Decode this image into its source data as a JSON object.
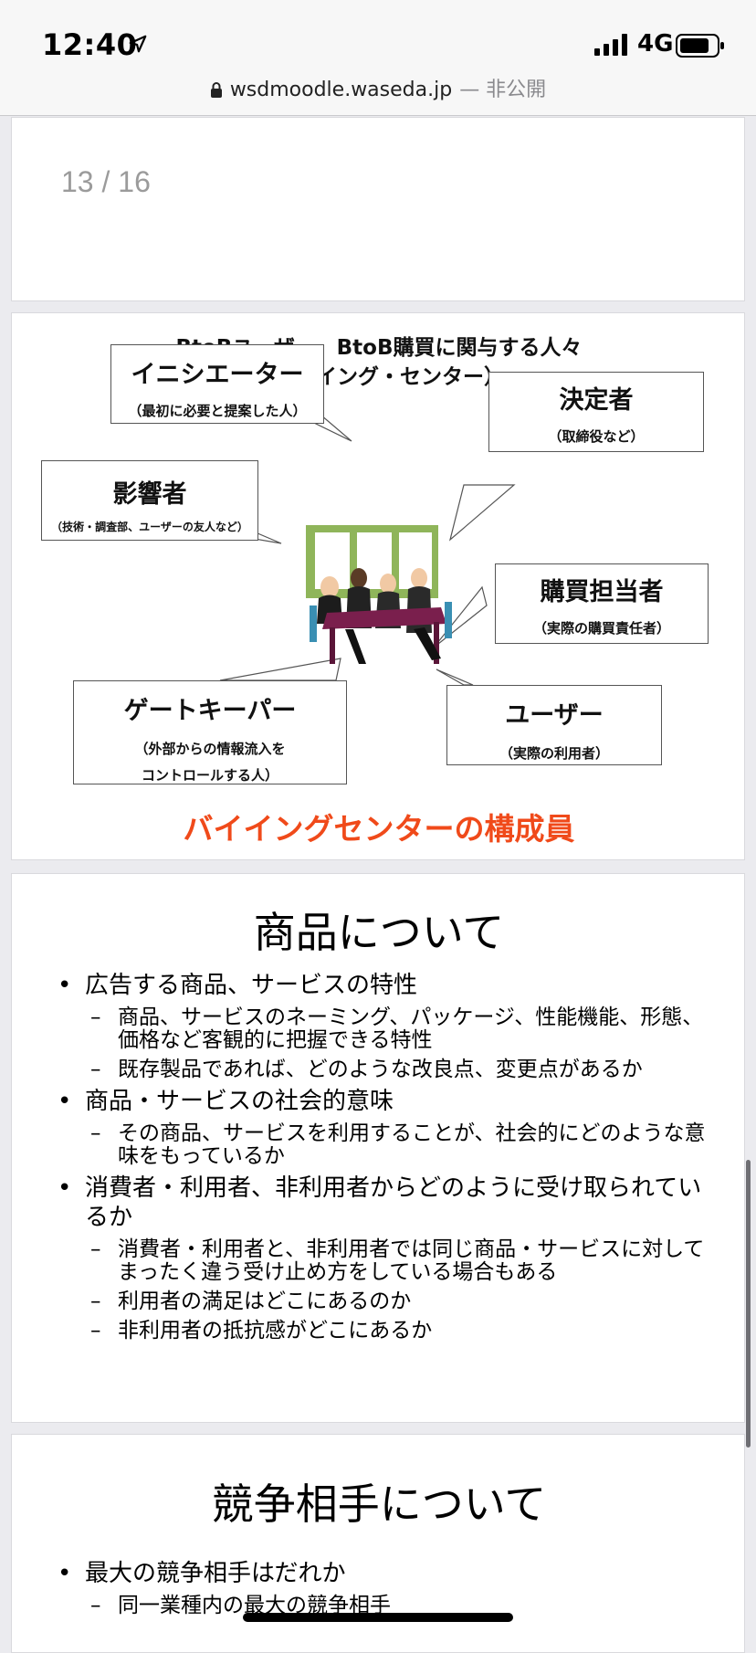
{
  "status_bar": {
    "time": "12:40",
    "network": "4G"
  },
  "url_bar": {
    "domain": "wsdmoodle.waseda.jp",
    "suffix": "— 非公開"
  },
  "pdf": {
    "page_indicator": "13 / 16"
  },
  "slide_buying_center": {
    "title_line1": "BtoBユーザー、BtoB購買に関与する人々",
    "title_line2": "（バイイング・センター）",
    "roles": [
      {
        "name": "イニシエーター",
        "desc": "（最初に必要と提案した人）"
      },
      {
        "name": "決定者",
        "desc": "（取締役など）"
      },
      {
        "name": "影響者",
        "desc": "（技術・調査部、ユーザーの友人など）"
      },
      {
        "name": "購買担当者",
        "desc": "（実際の購買責任者）"
      },
      {
        "name": "ゲートキーパー",
        "desc": "（外部からの情報流入を",
        "desc2": "コントロールする人）"
      },
      {
        "name": "ユーザー",
        "desc": "（実際の利用者）"
      }
    ],
    "caption": "バイイングセンターの構成員"
  },
  "slide_product": {
    "title": "商品について",
    "bullets": [
      {
        "text": "広告する商品、サービスの特性",
        "subs": [
          "商品、サービスのネーミング、パッケージ、性能機能、形態、価格など客観的に把握できる特性",
          "既存製品であれば、どのような改良点、変更点があるか"
        ]
      },
      {
        "text": "商品・サービスの社会的意味",
        "subs": [
          "その商品、サービスを利用することが、社会的にどのような意味をもっているか"
        ]
      },
      {
        "text": "消費者・利用者、非利用者からどのように受け取られているか",
        "subs": [
          "消費者・利用者と、非利用者では同じ商品・サービスに対してまったく違う受け止め方をしている場合もある",
          "利用者の満足はどこにあるのか",
          "非利用者の抵抗感がどこにあるか"
        ]
      }
    ]
  },
  "slide_competitor": {
    "title": "競争相手について",
    "bullets": [
      {
        "text": "最大の競争相手はだれか",
        "subs": [
          "同一業種内の最大の競争相手"
        ]
      }
    ]
  },
  "colors": {
    "accent_red": "#f04a1a",
    "page_bg": "#ebebef"
  },
  "icons": [
    "location-arrow-icon",
    "signal-icon",
    "battery-icon",
    "lock-icon"
  ]
}
